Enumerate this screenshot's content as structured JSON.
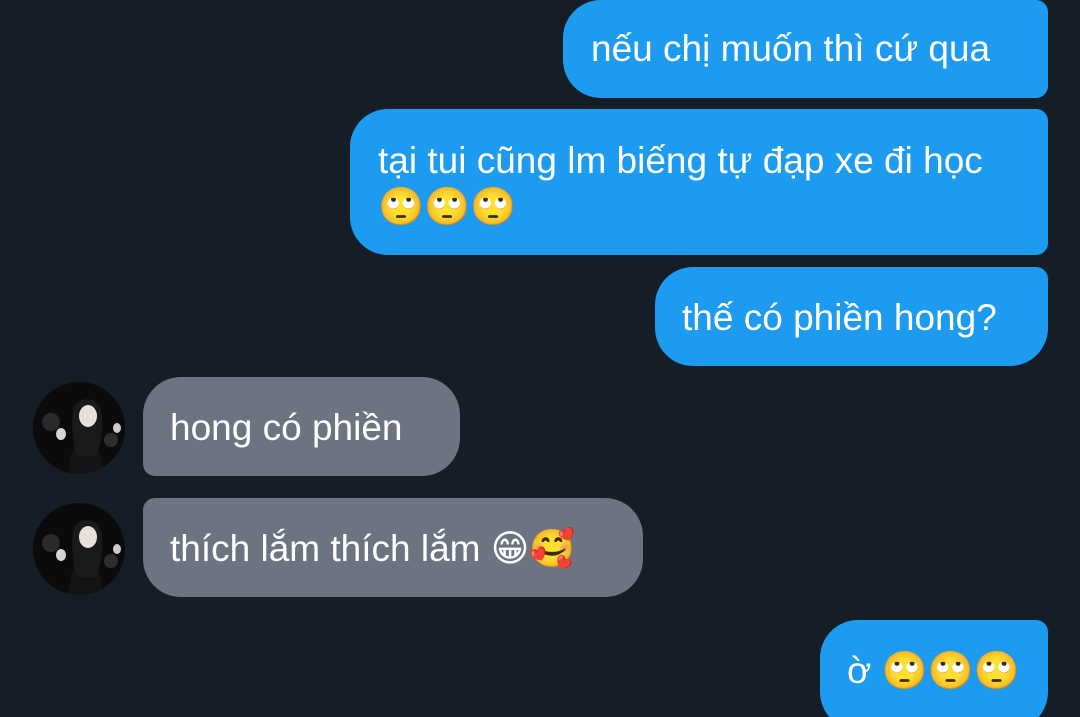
{
  "thread": {
    "outgoing": [
      {
        "text": "nếu chị muốn thì cứ qua"
      },
      {
        "text": "tại tui cũng lm biếng tự đạp xe đi học 🙄🙄🙄"
      },
      {
        "text": "thế có phiền hong?"
      },
      {
        "text": "ờ 🙄🙄🙄"
      }
    ],
    "incoming": [
      {
        "text": "hong có phiền",
        "avatar": "contact-avatar"
      },
      {
        "text": "thích lắm thích lắm 😁🥰",
        "avatar": "contact-avatar"
      }
    ]
  },
  "colors": {
    "background": "#151d26",
    "outgoing_bubble": "#1d9bf0",
    "incoming_bubble": "#6b7480",
    "text": "#ffffff"
  }
}
